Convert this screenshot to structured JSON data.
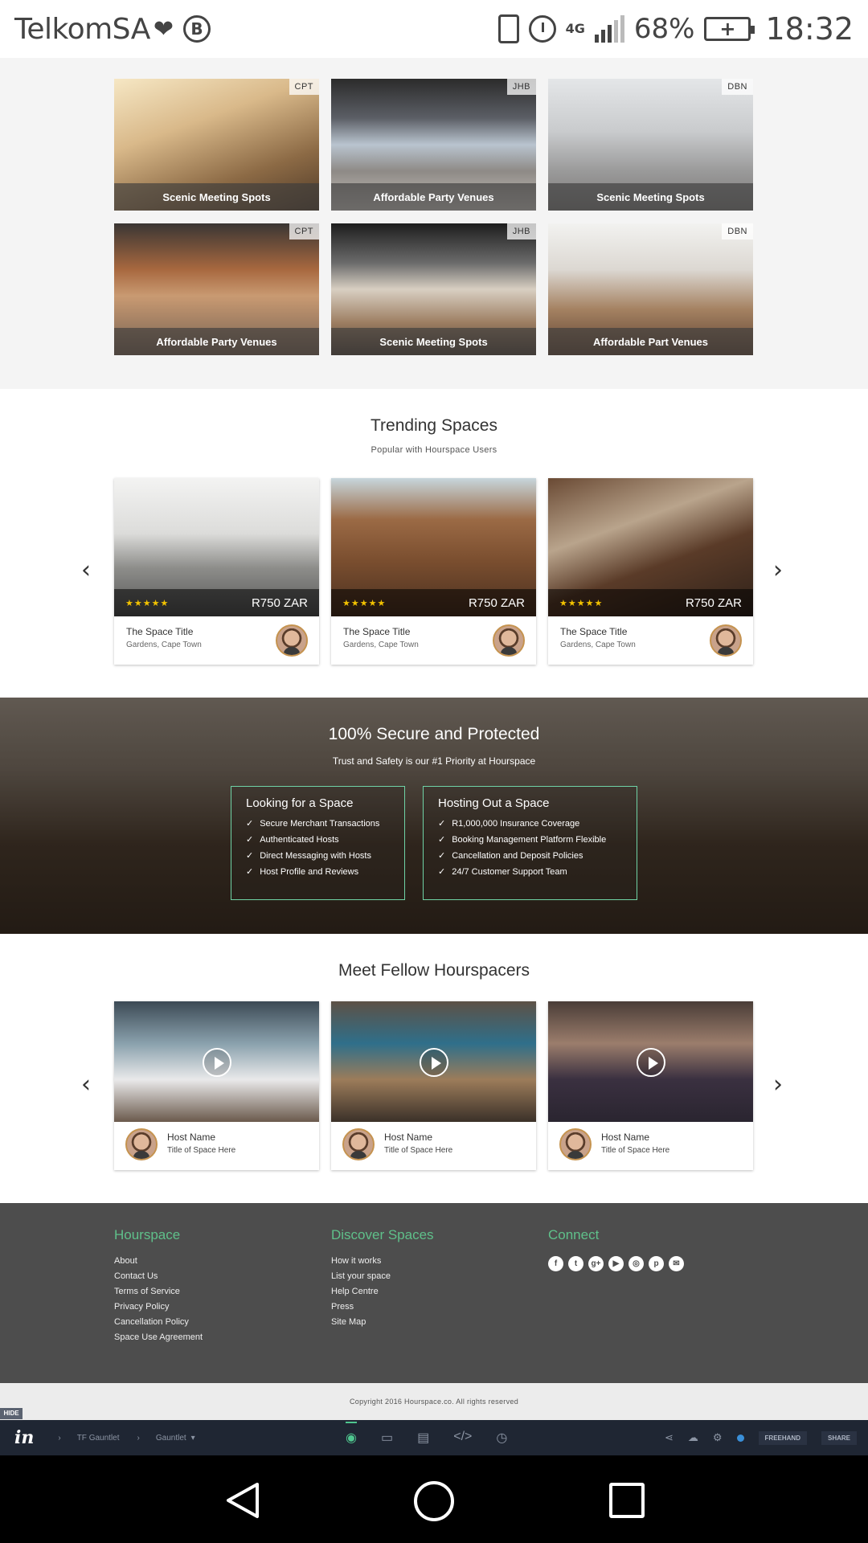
{
  "status": {
    "carrier": "TelkomSA",
    "network": "4G",
    "battery": "68%",
    "time": "18:32"
  },
  "venues": [
    {
      "city": "CPT",
      "caption": "Scenic Meeting Spots"
    },
    {
      "city": "JHB",
      "caption": "Affordable Party Venues"
    },
    {
      "city": "DBN",
      "caption": "Scenic Meeting Spots"
    },
    {
      "city": "CPT",
      "caption": "Affordable Party Venues"
    },
    {
      "city": "JHB",
      "caption": "Scenic Meeting Spots"
    },
    {
      "city": "DBN",
      "caption": "Affordable Part Venues"
    }
  ],
  "trending": {
    "title": "Trending Spaces",
    "subtitle": "Popular with Hourspace Users",
    "cards": [
      {
        "stars": "★★★★★",
        "price": "R750 ZAR",
        "title": "The Space Title",
        "location": "Gardens, Cape Town"
      },
      {
        "stars": "★★★★★",
        "price": "R750 ZAR",
        "title": "The Space Title",
        "location": "Gardens, Cape Town"
      },
      {
        "stars": "★★★★★",
        "price": "R750 ZAR",
        "title": "The Space Title",
        "location": "Gardens, Cape Town"
      }
    ]
  },
  "secure": {
    "title": "100% Secure and Protected",
    "subtitle": "Trust and Safety is our #1 Priority at Hourspace",
    "boxes": [
      {
        "title": "Looking for a Space",
        "items": [
          "Secure Merchant Transactions",
          "Authenticated Hosts",
          "Direct Messaging with Hosts",
          "Host Profile and Reviews"
        ]
      },
      {
        "title": "Hosting Out a Space",
        "items": [
          "R1,000,000 Insurance Coverage",
          "Booking Management Platform Flexible",
          "Cancellation and Deposit Policies",
          "24/7 Customer Support Team"
        ]
      }
    ]
  },
  "meet": {
    "title": "Meet Fellow Hourspacers",
    "cards": [
      {
        "name": "Host Name",
        "sub": "Title of Space Here"
      },
      {
        "name": "Host Name",
        "sub": "Title of Space Here"
      },
      {
        "name": "Host Name",
        "sub": "Title of Space Here"
      }
    ]
  },
  "footer": {
    "col1": {
      "title": "Hourspace",
      "links": [
        "About",
        "Contact Us",
        "Terms of Service",
        "Privacy Policy",
        "Cancellation Policy",
        "Space Use Agreement"
      ]
    },
    "col2": {
      "title": "Discover Spaces",
      "links": [
        "How it works",
        "List your space",
        "Help Centre",
        "Press",
        "Site Map"
      ]
    },
    "col3": {
      "title": "Connect",
      "icons": [
        "f",
        "t",
        "g+",
        "▶",
        "◎",
        "p",
        "✉"
      ]
    },
    "copyright": "Copyright 2016 Hourspace.co. All rights reserved"
  },
  "invision": {
    "hide": "HIDE",
    "logo": "in",
    "crumb1": "TF Gauntlet",
    "crumb2": "Gauntlet",
    "freehand": "FREEHAND",
    "share": "SHARE"
  },
  "colors": {
    "accent": "#5fc08a",
    "footer_bg": "#4d4d4d",
    "invision_bg": "#1f2633"
  }
}
